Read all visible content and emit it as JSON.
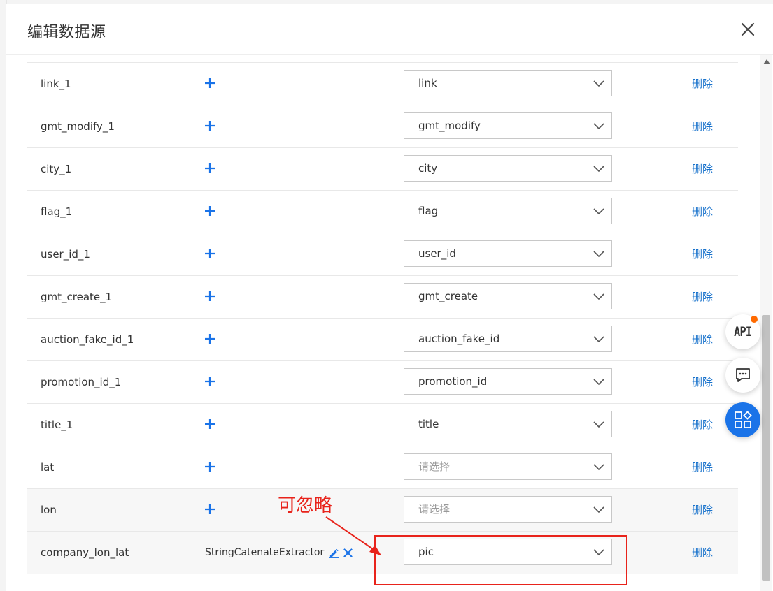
{
  "modal": {
    "title": "编辑数据源"
  },
  "rows": [
    {
      "field": "",
      "mapping": "",
      "delete_label": ""
    },
    {
      "field": "link_1",
      "mapping": "link",
      "delete_label": "删除"
    },
    {
      "field": "gmt_modify_1",
      "mapping": "gmt_modify",
      "delete_label": "删除"
    },
    {
      "field": "city_1",
      "mapping": "city",
      "delete_label": "删除"
    },
    {
      "field": "flag_1",
      "mapping": "flag",
      "delete_label": "删除"
    },
    {
      "field": "user_id_1",
      "mapping": "user_id",
      "delete_label": "删除"
    },
    {
      "field": "gmt_create_1",
      "mapping": "gmt_create",
      "delete_label": "删除"
    },
    {
      "field": "auction_fake_id_1",
      "mapping": "auction_fake_id",
      "delete_label": "删除"
    },
    {
      "field": "promotion_id_1",
      "mapping": "promotion_id",
      "delete_label": "删除"
    },
    {
      "field": "title_1",
      "mapping": "title",
      "delete_label": "删除"
    },
    {
      "field": "lat",
      "mapping": "请选择",
      "delete_label": "删除"
    },
    {
      "field": "lon",
      "mapping": "请选择",
      "delete_label": "删除"
    },
    {
      "field": "company_lon_lat",
      "extractor": "StringCatenateExtractor",
      "mapping": "pic",
      "delete_label": "删除"
    }
  ],
  "floating_buttons": {
    "api_label": "API"
  },
  "annotation": {
    "text": "可忽略"
  },
  "colors": {
    "accent": "#1a73e8",
    "link": "#1a73cc",
    "annotation": "#e8231b",
    "badge": "#ff6a00"
  }
}
